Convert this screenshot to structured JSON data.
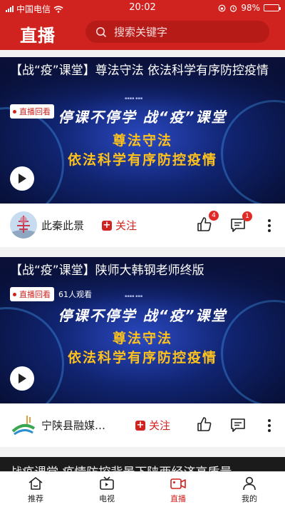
{
  "status_bar": {
    "carrier": "中国电信",
    "time": "20:02",
    "battery": "98%",
    "battery_level": 0.98
  },
  "header": {
    "title": "直播",
    "search_placeholder": "搜索关键字"
  },
  "poster": {
    "slogan_top": "停课不停学 战“疫”课堂",
    "slogan_line1": "尊法守法",
    "slogan_line2": "依法科学有序防控疫情"
  },
  "feed": [
    {
      "title": "【战“疫”课堂】尊法守法 依法科学有序防控疫情",
      "badge": "直播回看",
      "viewers": "",
      "author": "此秦此景",
      "follow_label": "关注",
      "like_count": "4",
      "comment_count": "1"
    },
    {
      "title": "【战“疫”课堂】陕师大韩钢老师终版",
      "badge": "直播回看",
      "viewers": "61人观看",
      "author": "宁陕县融媒…",
      "follow_label": "关注",
      "like_count": "",
      "comment_count": ""
    }
  ],
  "peek_title": "战疫课堂 疫情防控背景下陕西经济高质量",
  "tabs": [
    {
      "label": "推荐",
      "icon": "home-icon",
      "active": false
    },
    {
      "label": "电视",
      "icon": "tv-icon",
      "active": false
    },
    {
      "label": "直播",
      "icon": "video-camera-icon",
      "active": true
    },
    {
      "label": "我的",
      "icon": "user-icon",
      "active": false
    }
  ],
  "colors": {
    "brand": "#d0231f",
    "search_bg": "#b71b18",
    "poster_blue": "#10236e",
    "slogan_gold": "#ffc21c"
  }
}
